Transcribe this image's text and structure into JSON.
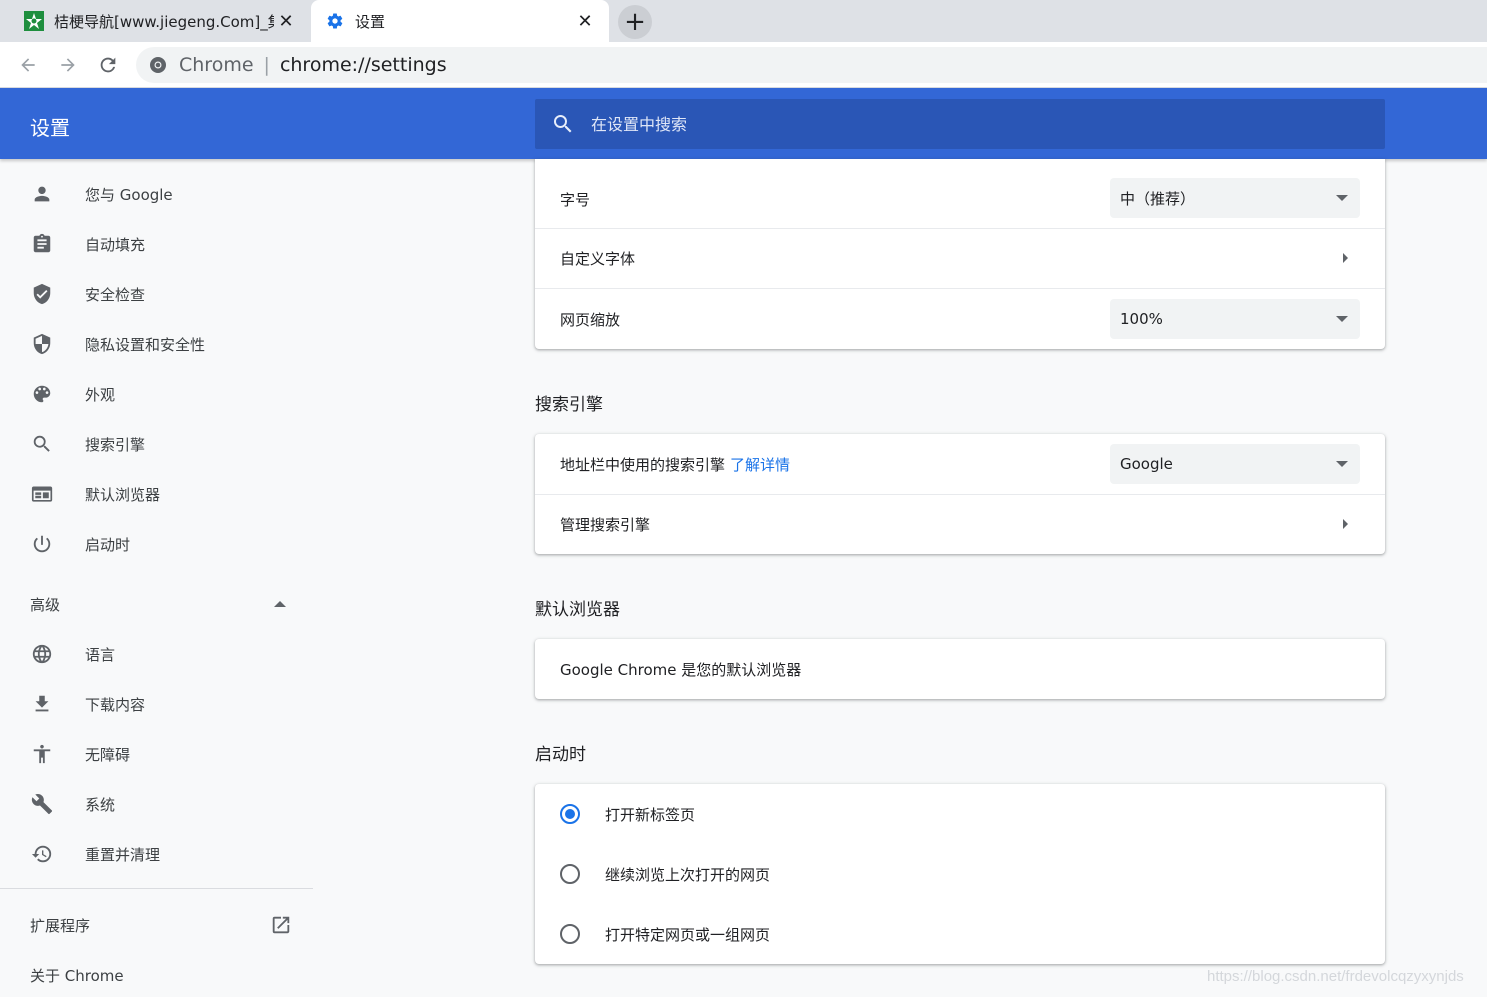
{
  "browser": {
    "tabs": [
      {
        "title": "桔梗导航[www.jiegeng.Com]_集",
        "favicon": "jiegeng-favicon"
      },
      {
        "title": "设置",
        "favicon": "gear-icon"
      }
    ],
    "omnibox": {
      "chip": "Chrome",
      "separator": "|",
      "url": "chrome://settings"
    }
  },
  "header": {
    "title": "设置",
    "search_placeholder": "在设置中搜索"
  },
  "sidebar": {
    "items": [
      {
        "label": "您与 Google",
        "icon": "person-icon"
      },
      {
        "label": "自动填充",
        "icon": "clipboard-icon"
      },
      {
        "label": "安全检查",
        "icon": "shield-check-icon"
      },
      {
        "label": "隐私设置和安全性",
        "icon": "shield-half-icon"
      },
      {
        "label": "外观",
        "icon": "palette-icon"
      },
      {
        "label": "搜索引擎",
        "icon": "search-icon"
      },
      {
        "label": "默认浏览器",
        "icon": "browser-icon"
      },
      {
        "label": "启动时",
        "icon": "power-icon"
      }
    ],
    "advanced_label": "高级",
    "advanced_items": [
      {
        "label": "语言",
        "icon": "globe-icon"
      },
      {
        "label": "下载内容",
        "icon": "download-icon"
      },
      {
        "label": "无障碍",
        "icon": "accessibility-icon"
      },
      {
        "label": "系统",
        "icon": "wrench-icon"
      },
      {
        "label": "重置并清理",
        "icon": "restore-icon"
      }
    ],
    "extensions_label": "扩展程序",
    "about_label": "关于 Chrome"
  },
  "appearance": {
    "font_size_label": "字号",
    "font_size_value": "中（推荐）",
    "custom_fonts_label": "自定义字体",
    "zoom_label": "网页缩放",
    "zoom_value": "100%"
  },
  "search_engine": {
    "section_title": "搜索引擎",
    "omnibox_label": "地址栏中使用的搜索引擎",
    "learn_more": "了解详情",
    "engine_value": "Google",
    "manage_label": "管理搜索引擎"
  },
  "default_browser": {
    "section_title": "默认浏览器",
    "status": "Google Chrome 是您的默认浏览器"
  },
  "on_startup": {
    "section_title": "启动时",
    "options": [
      {
        "label": "打开新标签页",
        "checked": true
      },
      {
        "label": "继续浏览上次打开的网页",
        "checked": false
      },
      {
        "label": "打开特定网页或一组网页",
        "checked": false
      }
    ]
  },
  "watermark": "https://blog.csdn.net/frdevolcqzyxynjds",
  "colors": {
    "header": "#3367d6",
    "search": "#2a56b6",
    "accent": "#1a73e8"
  }
}
